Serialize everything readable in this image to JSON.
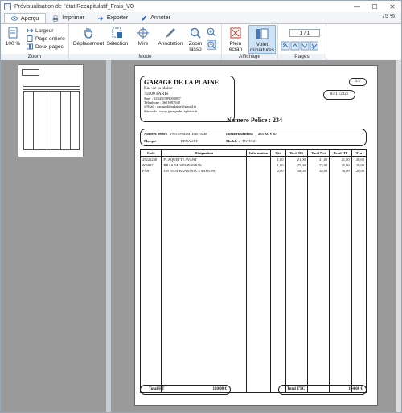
{
  "window": {
    "title": "Prévisualisation de l'état Recapitulatif_Frais_VO"
  },
  "window_buttons": {
    "minimize": "—",
    "maximize": "☐",
    "close": "✕"
  },
  "tabs": [
    {
      "label": "Aperçu",
      "icon": "eye-icon"
    },
    {
      "label": "Imprimer",
      "icon": "printer-icon"
    },
    {
      "label": "Exporter",
      "icon": "export-icon"
    },
    {
      "label": "Annoter",
      "icon": "pen-icon"
    }
  ],
  "zoom_level": "75 %",
  "ribbon": {
    "zoom_group": {
      "label": "Zoom",
      "percent_label": "100 %",
      "width_label": "Largeur",
      "full_page_label": "Page entière",
      "two_pages_label": "Deux pages"
    },
    "mode_group": {
      "label": "Mode",
      "move_label": "Déplacement",
      "select_label": "Sélection",
      "sight_label": "Mire",
      "annotation_label": "Annotation",
      "zoom_lasso_label": "Zoom lasso"
    },
    "display_group": {
      "label": "Affichage",
      "fullscreen_label": "Plein écran",
      "thumbnails_label": "Volet miniatures"
    },
    "pages_group": {
      "label": "Pages",
      "page_indicator": "1 / 1"
    }
  },
  "document": {
    "garage_name": "GARAGE DE LA PLAINE",
    "street": "Rue de la plaine",
    "city": "75000 PARIS",
    "siret": "Siret : 123456789000087",
    "phone": "Téléphone : 0601087940",
    "email": "@Mail : garagedelaplaine@gmail.fr",
    "website": "Site web : www.garage.de.laplaine.fr",
    "page_number": "1/1",
    "date": "05/11/2021",
    "police_label": "Numero Police :",
    "police_number": "234",
    "vehicle": {
      "serie_label": "Numero Serie :",
      "serie_value": "VF1G096DM1D3019248",
      "immat_label": "Immatriculation :",
      "immat_value": "253 AGV 87",
      "marque_label": "Marque",
      "marque_value": "RENAULT",
      "modele_label": "Modele :",
      "modele_value": "TWINGO"
    },
    "table": {
      "headers": [
        "Code",
        "Désignation",
        "Information",
        "Qté",
        "Tarif HS",
        "Tarif Net",
        "Total HT",
        "Tva"
      ],
      "rows": [
        [
          "25225238",
          "PLAQUETTE AVANT",
          "",
          "1,00",
          "21,00",
          "21,00",
          "21,00",
          "20,00"
        ],
        [
          "006807",
          "BRAS DE SUSPENSION",
          "",
          "1,00",
          "25,00",
          "25,00",
          "25,00",
          "20,00"
        ],
        [
          "PNS",
          "165 65 14 HANKOOK 4 SAISONS",
          "",
          "2,00",
          "38,00",
          "38,00",
          "76,00",
          "20,00"
        ]
      ]
    },
    "total_ht_label": "Total HT",
    "total_ht_value": "120,00 €",
    "total_ttc_label": "Total TTC",
    "total_ttc_value": "144,00 €"
  }
}
